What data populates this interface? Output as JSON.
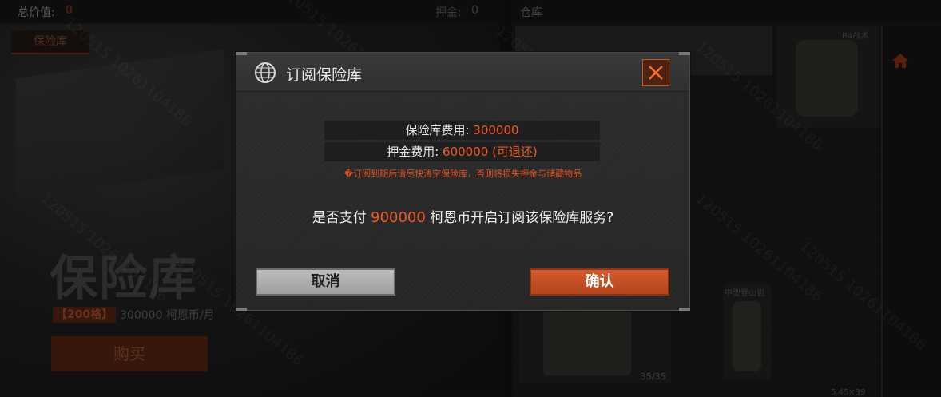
{
  "background": {
    "total_value_label": "总价值:",
    "total_value": "0",
    "deposit_label": "押金:",
    "deposit_value": "0",
    "vault_tab": "保险库",
    "vault_title": "保险库",
    "slots_badge": "【200格】",
    "price_text": "300000 柯恩币/月",
    "buy_button": "购买",
    "warehouse_label": "仓库",
    "item_label_b": "B4战术",
    "item_count": "35/35",
    "bag_label": "中型登山包",
    "ammo_label": "5.45×39"
  },
  "watermark_text": "120515 10261104186",
  "modal": {
    "title": "订阅保险库",
    "vault_fee_label": "保险库费用: ",
    "vault_fee_value": "300000",
    "deposit_fee_label": "押金费用: ",
    "deposit_fee_value": "600000 (可退还)",
    "warning": "�订阅到期后请尽快清空保险库，否则将损失押金与储藏物品",
    "question_prefix": "是否支付 ",
    "question_amount": "900000",
    "question_suffix": " 柯恩币开启订阅该保险库服务?",
    "cancel_label": "取消",
    "confirm_label": "确认"
  },
  "colors": {
    "accent": "#ee5a24",
    "confirm_bg": "#c4501f",
    "cancel_bg": "#b0b0b0"
  },
  "icons": {
    "header": "globe-icon",
    "close": "close-icon",
    "home": "home-icon"
  }
}
